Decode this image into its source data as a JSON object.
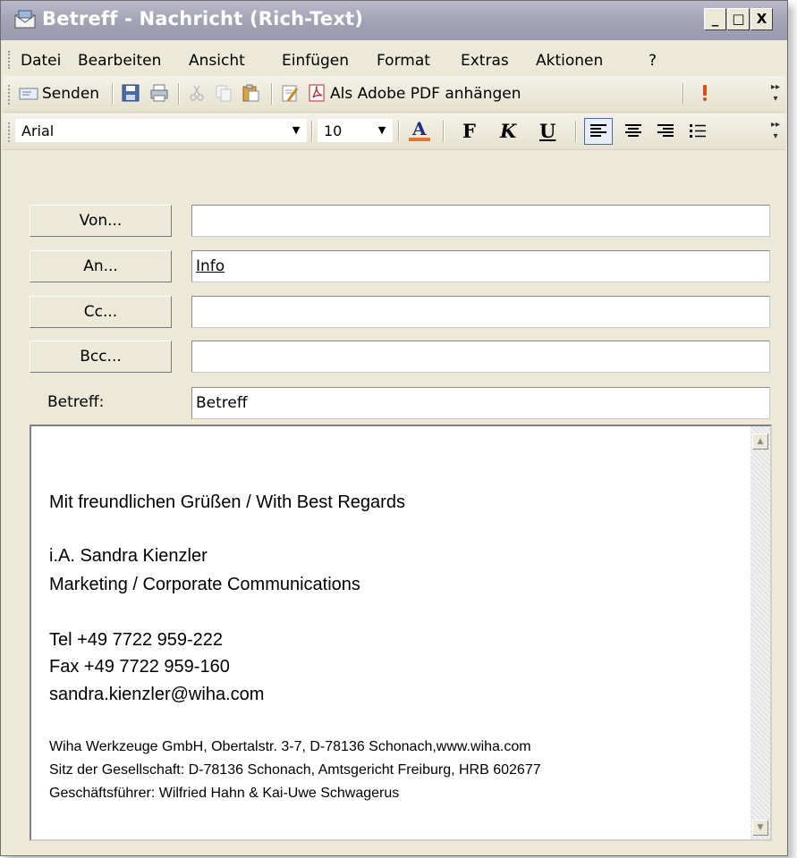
{
  "window": {
    "title": "Betreff - Nachricht (Rich-Text)",
    "controls": {
      "minimize": "_",
      "maximize": "□",
      "close": "X"
    }
  },
  "menu": [
    {
      "label": "Datei"
    },
    {
      "label": "Bearbeiten"
    },
    {
      "label": "Ansicht"
    },
    {
      "label": "Einfügen"
    },
    {
      "label": "Format"
    },
    {
      "label": "Extras"
    },
    {
      "label": "Aktionen"
    },
    {
      "label": "?"
    }
  ],
  "toolbar": {
    "send_label": "Senden",
    "pdf_label": "Als Adobe PDF anhängen",
    "icons": [
      "send-icon",
      "save-icon",
      "print-icon",
      "cut-icon",
      "copy-icon",
      "paste-icon",
      "attach-icon",
      "pdf-icon",
      "importance-icon"
    ]
  },
  "format_toolbar": {
    "font": "Arial",
    "size": "10",
    "bold": "F",
    "italic": "K",
    "underline": "U"
  },
  "address": {
    "from": {
      "button": "Von...",
      "value": ""
    },
    "to": {
      "button": "An...",
      "value": "Info"
    },
    "cc": {
      "button": "Cc...",
      "value": ""
    },
    "bcc": {
      "button": "Bcc...",
      "value": ""
    },
    "subject": {
      "label": "Betreff:",
      "value": "Betreff"
    }
  },
  "signature": {
    "greeting": "Mit freundlichen Grüßen / With Best Regards",
    "name": "i.A. Sandra Kienzler",
    "department": "Marketing / Corporate Communications",
    "tel": "Tel +49 7722 959-222",
    "fax": "Fax +49 7722 959-160",
    "email": "sandra.kienzler@wiha.com",
    "company": "Wiha Werkzeuge GmbH, Obertalstr. 3-7, D-78136 Schonach,www.wiha.com",
    "registry": "Sitz der Gesellschaft: D-78136 Schonach, Amtsgericht Freiburg, HRB 602677",
    "management": "Geschäftsführer: Wilfried Hahn & Kai-Uwe Schwagerus"
  },
  "colors": {
    "titlebar": "#a3a3b7",
    "font_color_bar": "#e2752a",
    "importance": "#e24a1a"
  }
}
